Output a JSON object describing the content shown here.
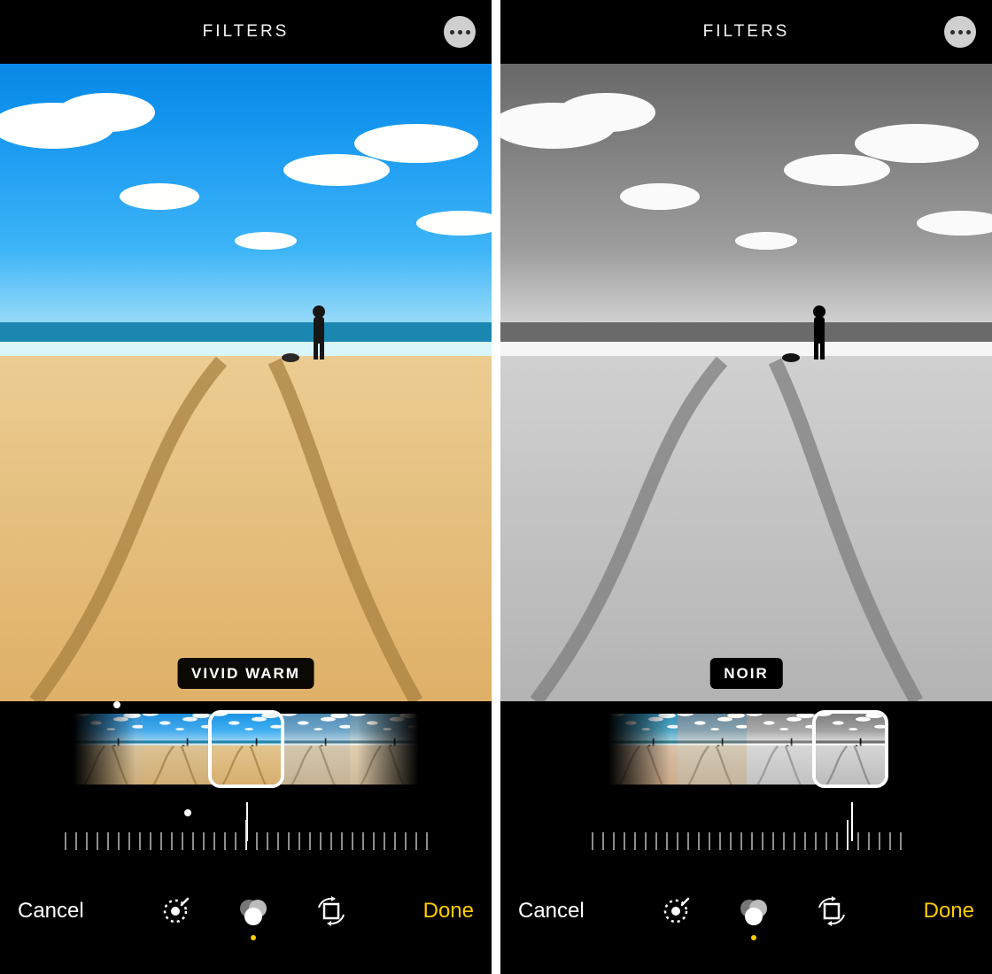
{
  "screens": [
    {
      "header": {
        "title": "FILTERS",
        "more_icon": "ellipsis-icon"
      },
      "filter_label": "VIVID WARM",
      "thumbnails": {
        "count": 5,
        "selected_index": 2,
        "marker_dot_index": 0
      },
      "ruler": {
        "indicator_pos": 0.5,
        "marker_dot_pos": 0.35
      },
      "tabbar": {
        "cancel": "Cancel",
        "done": "Done",
        "active_tool": "filters"
      }
    },
    {
      "header": {
        "title": "FILTERS",
        "more_icon": "ellipsis-icon"
      },
      "filter_label": "NOIR",
      "thumbnails": {
        "count": 4,
        "selected_index": 3,
        "marker_dot_index": null
      },
      "ruler": {
        "indicator_pos": 0.83,
        "marker_dot_pos": null
      },
      "tabbar": {
        "cancel": "Cancel",
        "done": "Done",
        "active_tool": "filters"
      }
    }
  ],
  "tools": {
    "adjust": "adjust-icon",
    "filters": "filters-icon",
    "crop": "crop-rotate-icon"
  },
  "colors": {
    "accent": "#ffcc00"
  }
}
